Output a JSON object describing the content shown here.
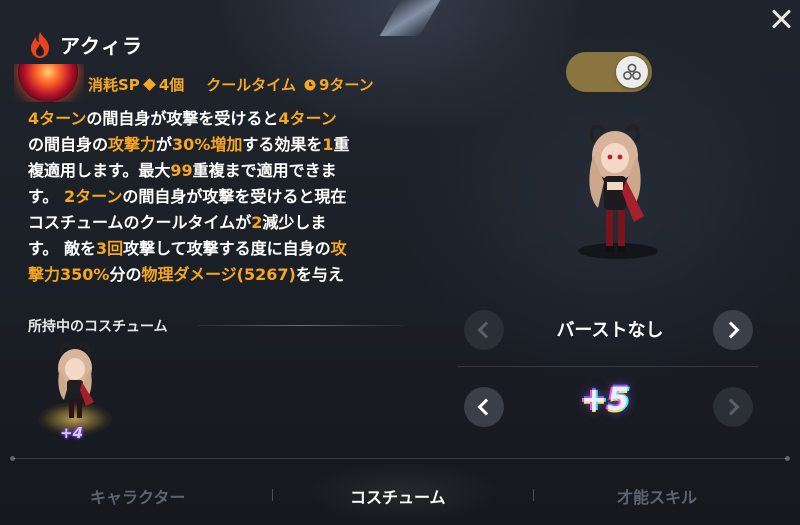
{
  "header": {
    "title": "アクィラ",
    "close_icon": "close-icon",
    "element_icon": "fire-icon"
  },
  "skill": {
    "cost_label": "消耗SP",
    "cost_value": "4個",
    "cooldown_label": "クールタイム",
    "cooldown_value": "9ターン",
    "description_lines": [
      [
        {
          "t": "4ターン",
          "o": true
        },
        {
          "t": "の間自身が攻撃を受けると",
          "o": false
        },
        {
          "t": "4ターン",
          "o": true
        }
      ],
      [
        {
          "t": "の間自身の",
          "o": false
        },
        {
          "t": "攻撃力",
          "o": true
        },
        {
          "t": "が",
          "o": false
        },
        {
          "t": "30%増加",
          "o": true
        },
        {
          "t": "する効果を",
          "o": false
        },
        {
          "t": "1",
          "o": true
        },
        {
          "t": "重",
          "o": false
        }
      ],
      [
        {
          "t": "複適用します。最大",
          "o": false
        },
        {
          "t": "99",
          "o": true
        },
        {
          "t": "重複まで適用できま",
          "o": false
        }
      ],
      [
        {
          "t": "す。 ",
          "o": false
        },
        {
          "t": "2ターン",
          "o": true
        },
        {
          "t": "の間自身が攻撃を受けると現在",
          "o": false
        }
      ],
      [
        {
          "t": "コスチュームのクールタイムが",
          "o": false
        },
        {
          "t": "2",
          "o": true
        },
        {
          "t": "減少しま",
          "o": false
        }
      ],
      [
        {
          "t": "す。 敵を",
          "o": false
        },
        {
          "t": "3回",
          "o": true
        },
        {
          "t": "攻撃して攻撃する度に自身の",
          "o": false
        },
        {
          "t": "攻",
          "o": true
        }
      ],
      [
        {
          "t": "撃力350%",
          "o": true
        },
        {
          "t": "分の",
          "o": false
        },
        {
          "t": "物理ダメージ(5267)",
          "o": true
        },
        {
          "t": "を与え",
          "o": false
        }
      ]
    ]
  },
  "owned": {
    "label": "所持中のコスチューム",
    "upgrade": "+4"
  },
  "right_panel": {
    "toggle_on": true,
    "burst_label": "バーストなし",
    "upgrade_level": "+5"
  },
  "tabs": [
    {
      "label": "キャラクター",
      "active": false
    },
    {
      "label": "コスチューム",
      "active": true
    },
    {
      "label": "才能スキル",
      "active": false
    }
  ],
  "colors": {
    "accent_orange": "#f5a623",
    "toggle_track": "#8a7440",
    "background": "#1b1f26",
    "fire_red": "#e8421f"
  }
}
